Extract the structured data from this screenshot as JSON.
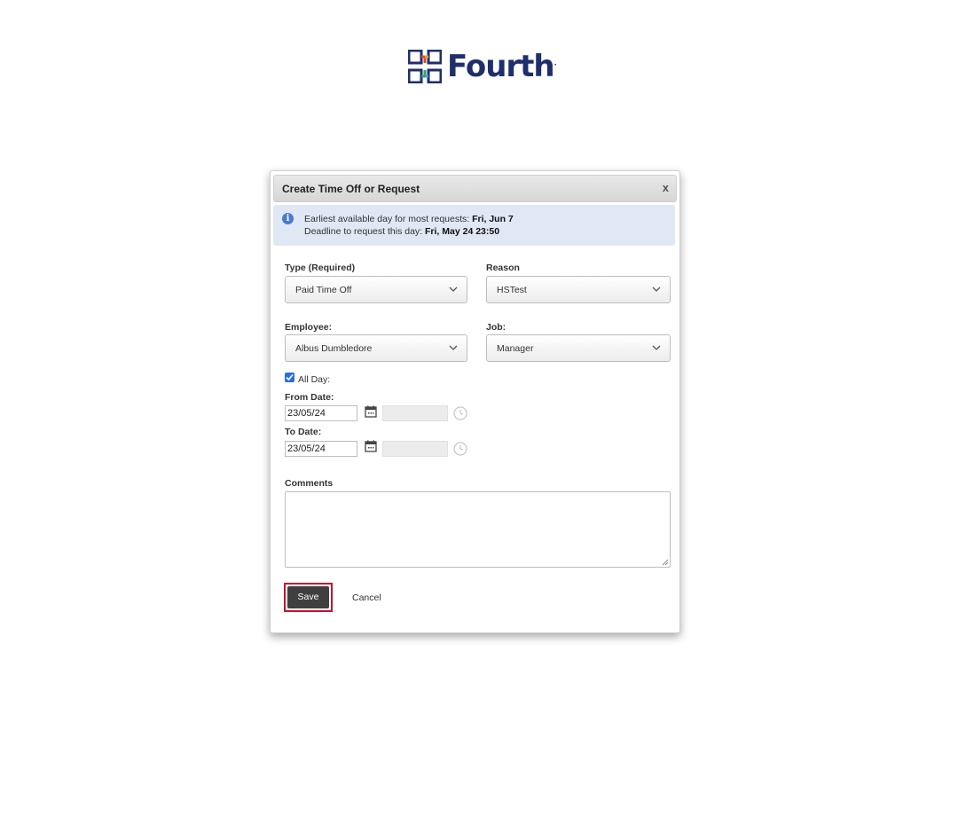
{
  "brand": {
    "name": "Fourth",
    "reg": "."
  },
  "dialog": {
    "title": "Create Time Off or Request",
    "close": "x",
    "info": {
      "line1_label": "Earliest available day for most requests:",
      "line1_value": "Fri, Jun 7",
      "line2_label": "Deadline to request this day:",
      "line2_value": "Fri, May 24 23:50"
    },
    "type": {
      "label": "Type (Required)",
      "value": "Paid Time Off"
    },
    "reason": {
      "label": "Reason",
      "value": "HSTest"
    },
    "employee": {
      "label": "Employee:",
      "value": "Albus Dumbledore"
    },
    "job": {
      "label": "Job:",
      "value": "Manager"
    },
    "all_day": {
      "label": "All Day:",
      "checked": true
    },
    "from_date": {
      "label": "From Date:",
      "value": "23/05/24"
    },
    "to_date": {
      "label": "To Date:",
      "value": "23/05/24"
    },
    "comments": {
      "label": "Comments",
      "value": ""
    },
    "save_label": "Save",
    "cancel_label": "Cancel"
  },
  "colors": {
    "accent": "#c8102e",
    "brand": "#1f2f6b",
    "info_bg": "#dfe8f4"
  }
}
